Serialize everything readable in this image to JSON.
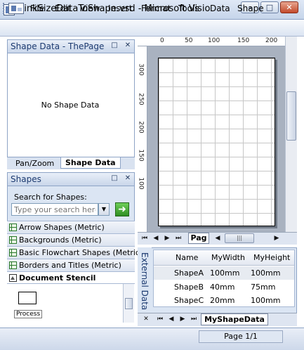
{
  "window": {
    "title": "LinkSizeDataToShape.vsd - Microsoft Visio",
    "minimize": "–",
    "maximize": "□",
    "close": "✕"
  },
  "menu": [
    "File",
    "Edit",
    "View",
    "Insert",
    "Format",
    "Tools",
    "Data",
    "Shape"
  ],
  "shape_data_panel": {
    "title": "Shape Data - ThePage",
    "empty_message": "No Shape Data",
    "tabs": [
      "Pan/Zoom",
      "Shape Data"
    ],
    "active_tab": "Shape Data"
  },
  "shapes_panel": {
    "title": "Shapes",
    "search_label": "Search for Shapes:",
    "search_placeholder": "Type your search here",
    "stencils": [
      "Arrow Shapes (Metric)",
      "Backgrounds (Metric)",
      "Basic Flowchart Shapes (Metric)",
      "Borders and Titles (Metric)"
    ],
    "document_stencil": "Document Stencil",
    "masters": [
      "Process"
    ]
  },
  "ruler": {
    "top_labels": [
      "0",
      "50",
      "100",
      "150",
      "200"
    ],
    "left_labels": [
      "300",
      "250",
      "200",
      "150",
      "100"
    ]
  },
  "drawing": {
    "page_tab": "Pag"
  },
  "external_data": {
    "title": "External Data",
    "columns": [
      "Name",
      "MyWidth",
      "MyHeight"
    ],
    "rows": [
      [
        "ShapeA",
        "100mm",
        "100mm"
      ],
      [
        "ShapeB",
        "40mm",
        "75mm"
      ],
      [
        "ShapeC",
        "20mm",
        "100mm"
      ]
    ],
    "sheet_tab": "MyShapeData"
  },
  "status": {
    "page": "Page 1/1"
  },
  "icons": {
    "panel_close": "✕",
    "panel_options": "□",
    "nav_first": "⏮",
    "nav_prev": "◀",
    "nav_next": "▶",
    "nav_last": "⏭",
    "dropdown": "▼",
    "go": "➜"
  }
}
